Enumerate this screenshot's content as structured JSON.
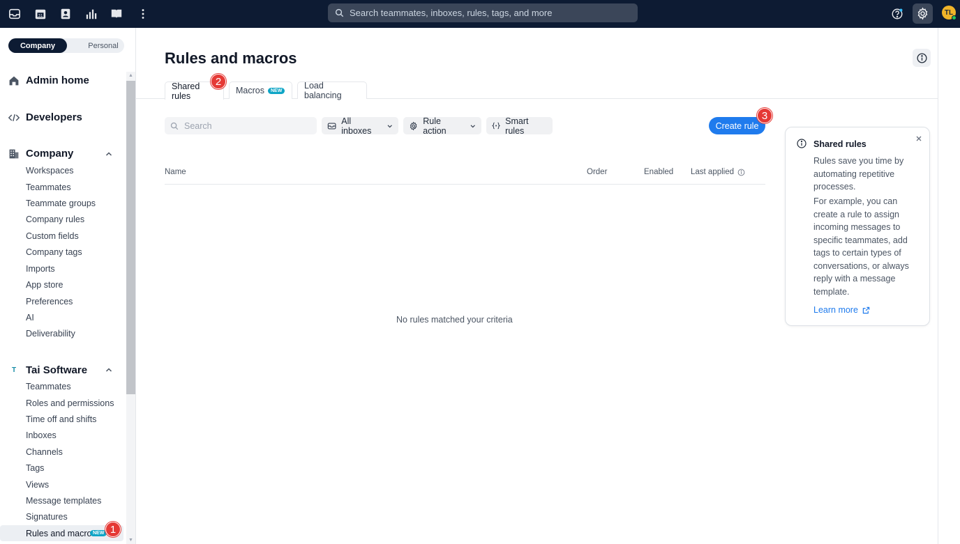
{
  "topbar": {
    "search_placeholder": "Search teammates, inboxes, rules, tags, and more",
    "avatar_initials": "TL",
    "icons": [
      "inbox-icon",
      "calendar-icon",
      "contacts-icon",
      "analytics-icon",
      "knowledge-base-icon",
      "more-icon",
      "help-icon",
      "settings-icon"
    ]
  },
  "sidebar": {
    "toggle": {
      "company": "Company",
      "personal": "Personal"
    },
    "admin_home": "Admin home",
    "developers": "Developers",
    "company_section": {
      "title": "Company",
      "items": [
        "Workspaces",
        "Teammates",
        "Teammate groups",
        "Company rules",
        "Custom fields",
        "Company tags",
        "Imports",
        "App store",
        "Preferences",
        "AI",
        "Deliverability"
      ]
    },
    "workspace_section": {
      "logo": "T",
      "title": "Tai Software",
      "items": [
        "Teammates",
        "Roles and permissions",
        "Time off and shifts",
        "Inboxes",
        "Channels",
        "Tags",
        "Views",
        "Message templates",
        "Signatures"
      ],
      "active_item": "Rules and macros",
      "active_badge": "NEW"
    }
  },
  "annotations": {
    "one": "1",
    "two": "2",
    "three": "3"
  },
  "main": {
    "title": "Rules and macros",
    "tabs": [
      {
        "label": "Shared rules"
      },
      {
        "label": "Macros",
        "badge": "NEW"
      },
      {
        "label": "Load balancing"
      }
    ],
    "search_placeholder": "Search",
    "filters": {
      "inboxes": "All inboxes",
      "rule_action": "Rule action",
      "smart_rules": "Smart rules"
    },
    "create_button": "Create rule",
    "columns": {
      "name": "Name",
      "order": "Order",
      "enabled": "Enabled",
      "last_applied": "Last applied"
    },
    "empty_message": "No rules matched your criteria"
  },
  "info_panel": {
    "title": "Shared rules",
    "paragraph1": "Rules save you time by automating repetitive processes.",
    "paragraph2": "For example, you can create a rule to assign incoming messages to specific teammates, add tags to certain types of conversations, or always reply with a message template.",
    "link": "Learn more"
  },
  "colors": {
    "topbar": "#0d1b33",
    "primary": "#1f7bed",
    "badge": "#0ea5c6",
    "annotation": "#e53935"
  }
}
